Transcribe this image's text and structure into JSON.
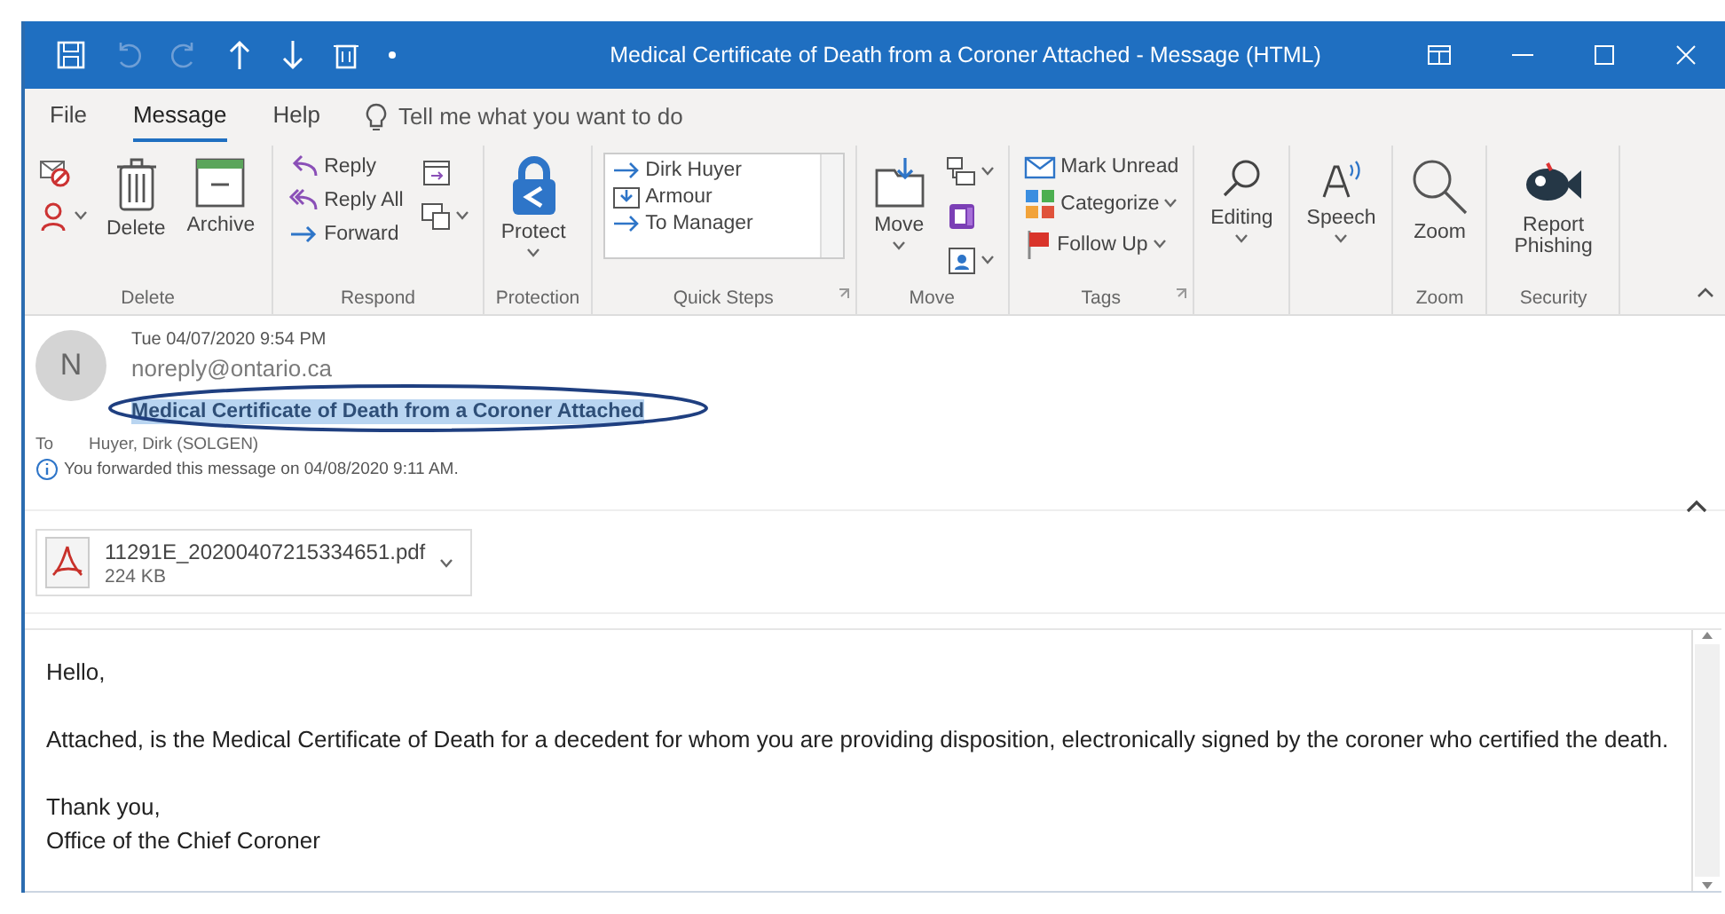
{
  "window": {
    "title": "Medical Certificate of Death from a Coroner Attached  -  Message (HTML)"
  },
  "menu_tabs": [
    {
      "label": "File",
      "selected": false
    },
    {
      "label": "Message",
      "selected": true
    },
    {
      "label": "Help",
      "selected": false
    }
  ],
  "tell_me": {
    "placeholder": "Tell me what you want to do"
  },
  "ribbon_groups": [
    {
      "label": "Delete",
      "columns": [
        [
          {
            "kind": "icon"
          },
          {
            "kind": "icon",
            "dropdown": true
          }
        ],
        [
          {
            "kind": "large",
            "label": "Delete"
          }
        ],
        [
          {
            "kind": "large",
            "label": "Archive"
          }
        ]
      ]
    },
    {
      "label": "Respond",
      "columns": [
        [
          {
            "kind": "small",
            "label": "Reply"
          },
          {
            "kind": "small",
            "label": "Reply All"
          },
          {
            "kind": "small",
            "label": "Forward"
          }
        ],
        [
          {
            "kind": "icon"
          },
          {
            "kind": "icon",
            "dropdown": true
          }
        ]
      ]
    },
    {
      "label": "Protection",
      "columns": [
        [
          {
            "kind": "large",
            "label": "Protect",
            "dropdown": true
          }
        ]
      ]
    },
    {
      "label": "Quick Steps",
      "launcher": true,
      "columns": [
        [
          {
            "kind": "gallery",
            "entries": [
              "Dirk Huyer",
              "Armour",
              "To Manager"
            ]
          }
        ]
      ]
    },
    {
      "label": "Move",
      "columns": [
        [
          {
            "kind": "large",
            "label": "Move",
            "dropdown": true
          }
        ],
        [
          {
            "kind": "icon",
            "dropdown": true
          },
          {
            "kind": "icon"
          },
          {
            "kind": "icon",
            "dropdown": true
          }
        ]
      ]
    },
    {
      "label": "Tags",
      "launcher": true,
      "columns": [
        [
          {
            "kind": "small",
            "label": "Mark Unread"
          },
          {
            "kind": "small",
            "label": "Categorize",
            "dropdown": true
          },
          {
            "kind": "small",
            "label": "Follow Up",
            "dropdown": true
          }
        ]
      ]
    },
    {
      "columns": [
        [
          {
            "kind": "large",
            "label": "Editing",
            "dropdown": true
          }
        ]
      ]
    },
    {
      "columns": [
        [
          {
            "kind": "large",
            "label": "Speech",
            "dropdown": true
          }
        ]
      ]
    },
    {
      "label": "Zoom",
      "columns": [
        [
          {
            "kind": "large",
            "label": "Zoom"
          }
        ]
      ]
    },
    {
      "label": "Security",
      "columns": [
        [
          {
            "kind": "large",
            "label": "Report Phishing"
          }
        ]
      ]
    }
  ],
  "message": {
    "avatar_initial": "N",
    "date": "Tue 04/07/2020 9:54 PM",
    "sender": "noreply@ontario.ca",
    "subject": "Medical Certificate of Death from a Coroner Attached",
    "to_label": "To",
    "recipient": "Huyer, Dirk (SOLGEN)",
    "info": "You forwarded this message on 04/08/2020 9:11 AM."
  },
  "attachment": {
    "name": "11291E_20200407215334651.pdf",
    "size": "224 KB"
  },
  "body": [
    "Hello,",
    "Attached, is the Medical Certificate of Death for a decedent for whom you are providing disposition, electronically signed by the coroner who certified the death.",
    "Thank you,\nOffice of the Chief Coroner"
  ]
}
